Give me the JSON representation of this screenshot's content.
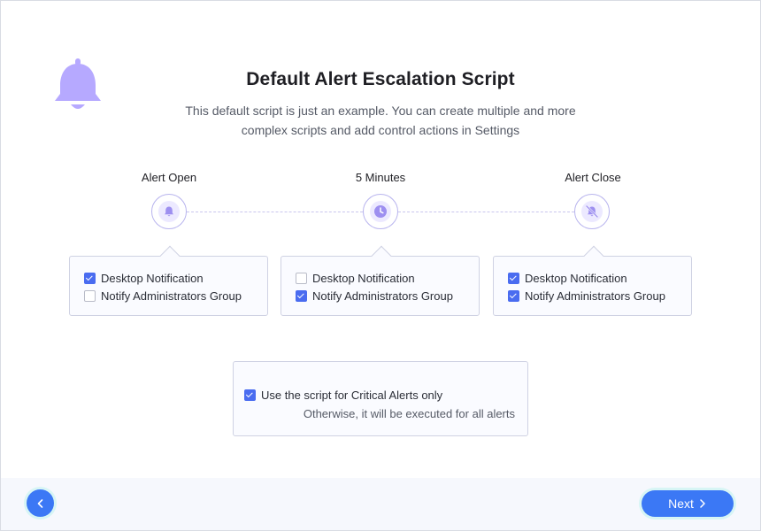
{
  "header": {
    "title": "Default Alert Escalation Script",
    "subtitle": "This default script is just an example. You can create multiple and more complex scripts and add control actions in Settings",
    "hero_icon": "bell-icon"
  },
  "stages": [
    {
      "label": "Alert Open",
      "icon": "bell-icon",
      "options": [
        {
          "label": "Desktop Notification",
          "checked": true
        },
        {
          "label": "Notify Administrators Group",
          "checked": false
        }
      ]
    },
    {
      "label": "5 Minutes",
      "icon": "clock-icon",
      "options": [
        {
          "label": "Desktop Notification",
          "checked": false
        },
        {
          "label": "Notify Administrators Group",
          "checked": true
        }
      ]
    },
    {
      "label": "Alert Close",
      "icon": "bell-off-icon",
      "options": [
        {
          "label": "Desktop Notification",
          "checked": true
        },
        {
          "label": "Notify Administrators Group",
          "checked": true
        }
      ]
    }
  ],
  "critical": {
    "label": "Use the script for Critical Alerts only",
    "checked": true,
    "note": "Otherwise, it will be executed for all alerts"
  },
  "footer": {
    "back_icon": "chevron-left-icon",
    "next_label": "Next",
    "next_icon": "chevron-right-icon"
  },
  "colors": {
    "accent": "#3b78f5",
    "checkbox": "#4a6cf0",
    "icon_purple": "#9d8ff0"
  }
}
